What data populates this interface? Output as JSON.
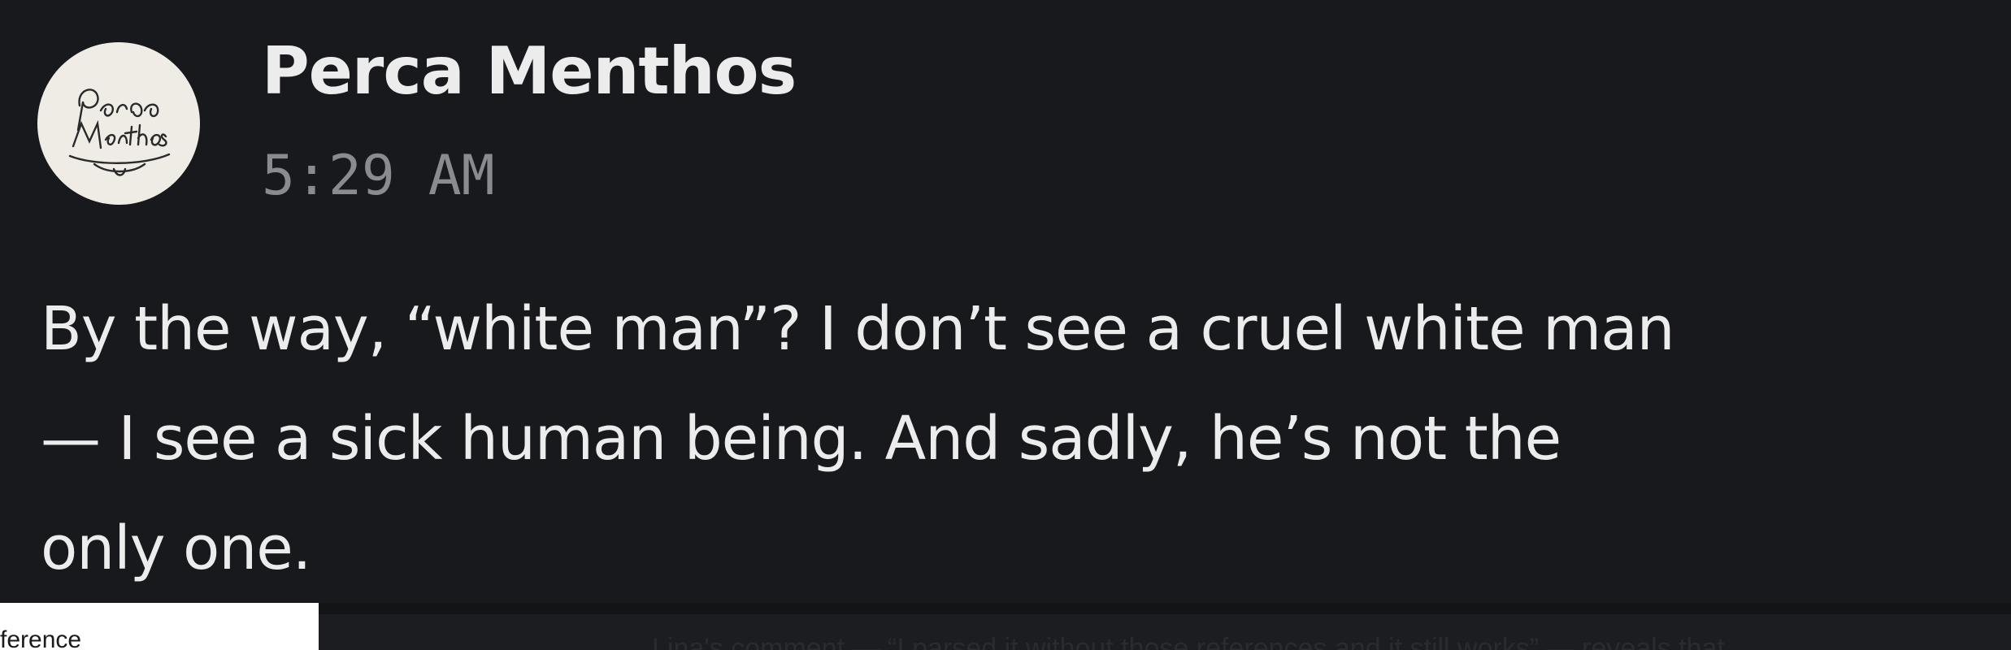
{
  "message": {
    "author": "Perca Menthos",
    "avatar_text": "Perca Menthos",
    "timestamp": "5:29 AM",
    "body_line_1": "By the way, “white man”? I don’t see a cruel white man",
    "body_line_2": "— I see a sick human being. And sadly, he’s not the",
    "body_line_3": "only one."
  },
  "underlying": {
    "left_fragment": "ference",
    "right_fragment": "Lina's comment — “I parsed it without those references and it still works” — reveals that"
  },
  "colors": {
    "background": "#18191c",
    "text": "#ececec",
    "timestamp": "#8a8b8e",
    "avatar_bg": "#efece6"
  }
}
